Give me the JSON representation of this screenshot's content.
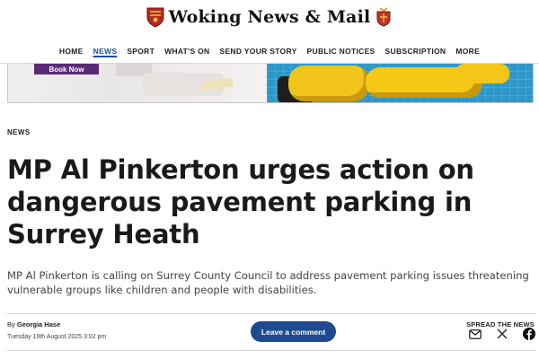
{
  "masthead": {
    "title": "Woking News & Mail",
    "crest_icon": "crest-icon",
    "crest_right_icon": "crest-icon"
  },
  "nav": {
    "items": [
      {
        "label": "HOME",
        "active": false
      },
      {
        "label": "NEWS",
        "active": true
      },
      {
        "label": "SPORT",
        "active": false
      },
      {
        "label": "WHAT'S ON",
        "active": false
      },
      {
        "label": "SEND YOUR STORY",
        "active": false
      },
      {
        "label": "PUBLIC NOTICES",
        "active": false
      },
      {
        "label": "SUBSCRIPTION",
        "active": false
      },
      {
        "label": "MORE",
        "active": false
      }
    ],
    "accent_color": "#1c4f9c"
  },
  "banner": {
    "button_label": "Book Now",
    "button_color": "#5b2a76"
  },
  "article": {
    "section": "NEWS",
    "headline": "MP Al Pinkerton urges action on dangerous pavement parking in Surrey Heath",
    "standfirst": "MP Al Pinkerton is calling on Surrey County Council to address pavement parking issues threatening vulnerable groups like children and people with disabilities.",
    "byline_prefix": "By",
    "author": "Georgia Hase",
    "date": "Tuesday 19th August 2025 3:02 pm"
  },
  "actions": {
    "comment_label": "Leave a comment",
    "comment_color": "#1f4a8f",
    "share_label": "SPREAD THE NEWS",
    "share_icons": [
      "email-icon",
      "x-icon",
      "facebook-icon"
    ]
  }
}
